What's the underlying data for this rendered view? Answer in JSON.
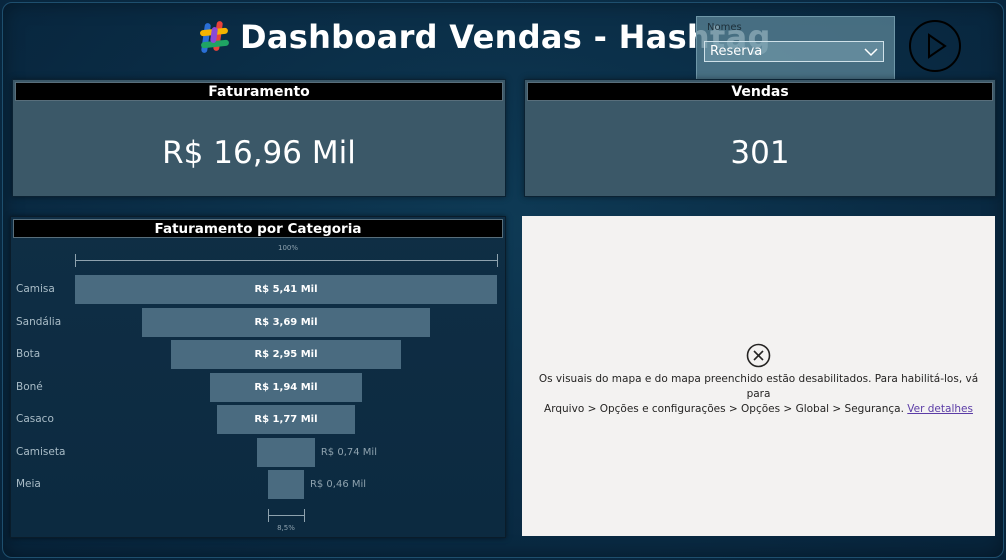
{
  "header": {
    "title": "Dashboard Vendas - Hashtag"
  },
  "slicer": {
    "label": "Nomes",
    "selected": "Reserva",
    "icon": "chevron-down-icon"
  },
  "play_button": {
    "icon": "play-icon"
  },
  "kpis": [
    {
      "title": "Faturamento",
      "value": "R$ 16,96 Mil"
    },
    {
      "title": "Vendas",
      "value": "301"
    }
  ],
  "funnel": {
    "title": "Faturamento por Categoria",
    "top_scale_label": "100%",
    "bottom_scale_label": "8,5%",
    "bar_color": "#4a6b80"
  },
  "chart_data": {
    "type": "bar",
    "title": "Faturamento por Categoria",
    "categories": [
      "Camisa",
      "Sandália",
      "Bota",
      "Boné",
      "Casaco",
      "Camiseta",
      "Meia"
    ],
    "values": [
      5.41,
      3.69,
      2.95,
      1.94,
      1.77,
      0.74,
      0.46
    ],
    "labels": [
      "R$ 5,41 Mil",
      "R$ 3,69 Mil",
      "R$ 2,95 Mil",
      "R$ 1,94 Mil",
      "R$ 1,77 Mil",
      "R$ 0,74 Mil",
      "R$ 0,46 Mil"
    ]
  },
  "map": {
    "icon": "close-circle-icon",
    "message_line1": "Os visuais do mapa e do mapa preenchido estão desabilitados. Para habilitá-los, vá para",
    "message_line2": "Arquivo > Opções e configurações > Opções > Global > Segurança.",
    "link": "Ver detalhes"
  }
}
